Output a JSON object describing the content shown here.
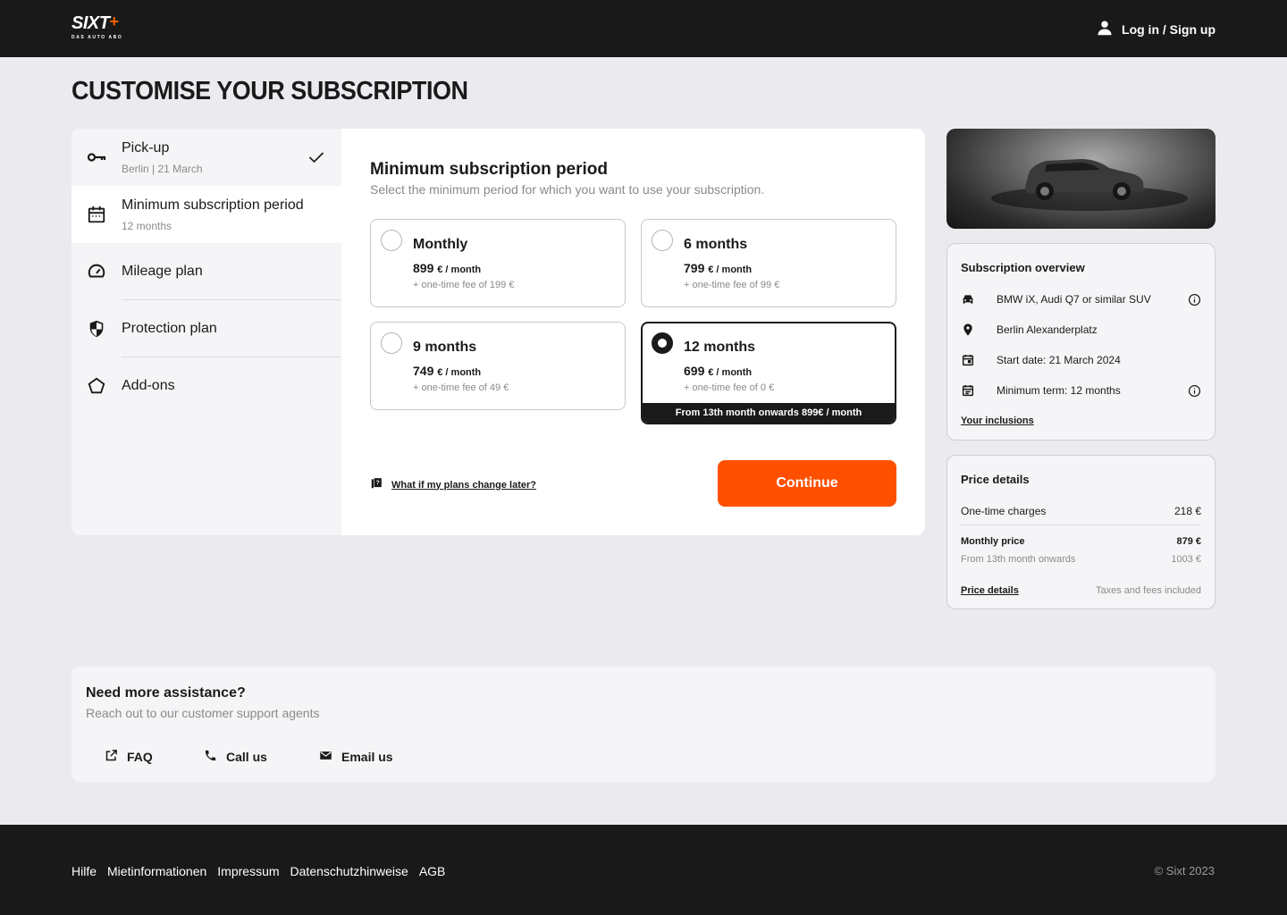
{
  "header": {
    "logo_text": "SIXT",
    "logo_plus": "+",
    "logo_tagline": "DAS AUTO ABO",
    "login_label": "Log in / Sign up",
    "bg_color": "#191919",
    "accent_color": "#ff5000"
  },
  "page_title": "CUSTOMISE YOUR SUBSCRIPTION",
  "steps": [
    {
      "label": "Pick-up",
      "sub": "Berlin | 21 March",
      "icon": "key-icon",
      "status": "completed"
    },
    {
      "label": "Minimum subscription period",
      "sub": "12 months",
      "icon": "calendar-icon",
      "status": "active"
    },
    {
      "label": "Mileage plan",
      "sub": "",
      "icon": "speedometer-icon",
      "status": "pending"
    },
    {
      "label": "Protection plan",
      "sub": "",
      "icon": "shield-icon",
      "status": "pending"
    },
    {
      "label": "Add-ons",
      "sub": "",
      "icon": "pentagon-icon",
      "status": "pending"
    }
  ],
  "period_panel": {
    "title": "Minimum subscription period",
    "description": "Select the minimum period for which you want to use your subscription.",
    "options": [
      {
        "name": "Monthly",
        "price": "899",
        "unit": "€ / month",
        "fee": "+ one-time fee of  199 €",
        "selected": false,
        "banner": ""
      },
      {
        "name": "6 months",
        "price": "799",
        "unit": "€ / month",
        "fee": "+ one-time fee of  99 €",
        "selected": false,
        "banner": ""
      },
      {
        "name": "9 months",
        "price": "749",
        "unit": "€ / month",
        "fee": "+ one-time fee of  49 €",
        "selected": false,
        "banner": ""
      },
      {
        "name": "12 months",
        "price": "699",
        "unit": "€ / month",
        "fee": "+ one-time fee of  0 €",
        "selected": true,
        "banner": "From 13th month onwards 899€ / month"
      }
    ],
    "help_link": "What if my plans change later?",
    "continue_label": "Continue"
  },
  "overview": {
    "title": "Subscription overview",
    "rows": [
      {
        "icon": "car-icon",
        "text": "BMW iX, Audi Q7 or similar SUV",
        "info": true
      },
      {
        "icon": "location-pin-icon",
        "text": "Berlin Alexanderplatz",
        "info": false
      },
      {
        "icon": "calendar-icon",
        "text": "Start date: 21 March 2024",
        "info": false
      },
      {
        "icon": "calendar-note-icon",
        "text": "Minimum term: 12 months",
        "info": true
      }
    ],
    "inclusions_link": "Your inclusions"
  },
  "price_details": {
    "title": "Price details",
    "one_time_label": "One-time charges",
    "one_time_value": "218 €",
    "monthly_label": "Monthly price",
    "monthly_value": "879 €",
    "onwards_label": "From 13th month onwards",
    "onwards_value": "1003 €",
    "details_link": "Price details",
    "taxes_note": "Taxes and fees included"
  },
  "assistance": {
    "title": "Need more assistance?",
    "subtitle": "Reach out to our customer support agents",
    "links": [
      {
        "label": "FAQ",
        "icon": "external-link-icon"
      },
      {
        "label": "Call us",
        "icon": "phone-icon"
      },
      {
        "label": "Email us",
        "icon": "email-icon"
      }
    ]
  },
  "footer": {
    "links": [
      "Hilfe",
      "Mietinformationen",
      "Impressum",
      "Datenschutzhinweise",
      "AGB"
    ],
    "copyright": "© Sixt 2023"
  }
}
